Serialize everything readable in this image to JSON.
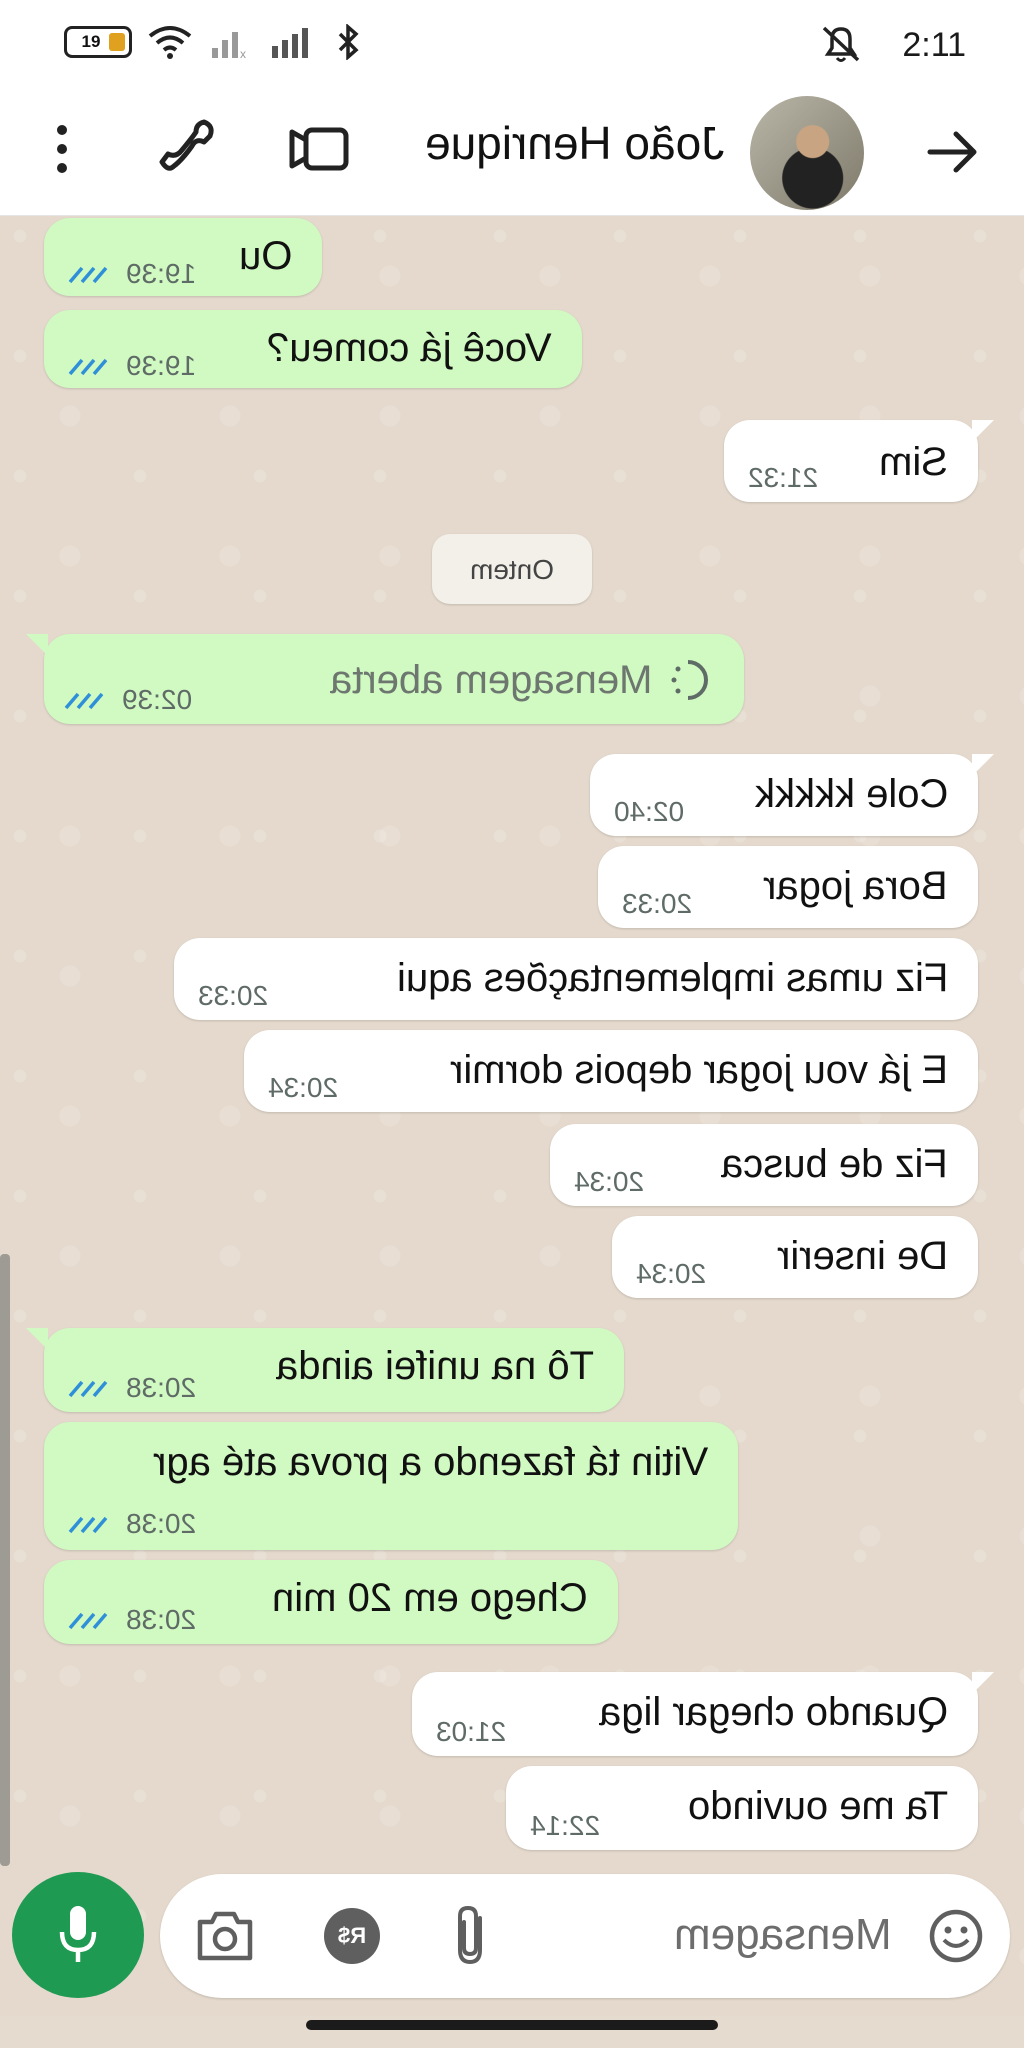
{
  "status_bar": {
    "time": "2:11",
    "battery_level": "19"
  },
  "header": {
    "contact_name": "João Henrique"
  },
  "date_separator": "Ontem",
  "messages": [
    {
      "text": "Ou",
      "time": "19:39",
      "direction": "out"
    },
    {
      "text": "Você já comeu?",
      "time": "19:39",
      "direction": "out"
    },
    {
      "text": "Sim",
      "time": "21:32",
      "direction": "in"
    },
    {
      "text": "Mensagem aberta",
      "time": "02:39",
      "direction": "out"
    },
    {
      "text": "Cole kkkkk",
      "time": "02:40",
      "direction": "in"
    },
    {
      "text": "Bora jogar",
      "time": "20:33",
      "direction": "in"
    },
    {
      "text": "Fiz umas implementações aqui",
      "time": "20:33",
      "direction": "in"
    },
    {
      "text": "E já vou jogar depois dormir",
      "time": "20:34",
      "direction": "in"
    },
    {
      "text": "Fiz de busca",
      "time": "20:34",
      "direction": "in"
    },
    {
      "text": "De inserir",
      "time": "20:34",
      "direction": "in"
    },
    {
      "text": "Tô na unifei ainda",
      "time": "20:38",
      "direction": "out"
    },
    {
      "text": "Vitin tá fazendo a prova até agr",
      "time": "20:38",
      "direction": "out"
    },
    {
      "text": "Chego em 20 min",
      "time": "20:38",
      "direction": "out"
    },
    {
      "text": "Quando chegar liga",
      "time": "21:03",
      "direction": "in"
    },
    {
      "text": "Ta me ouvindo",
      "time": "22:14",
      "direction": "in"
    }
  ],
  "composer": {
    "placeholder": "Mensagem",
    "payment_icon_label": "R$"
  },
  "colors": {
    "outgoing_bubble": "#d1f9c2",
    "incoming_bubble": "#ffffff",
    "wallpaper": "#e4d9cc",
    "mic_button": "#1f9a52",
    "read_ticks": "#2f8fd8"
  }
}
